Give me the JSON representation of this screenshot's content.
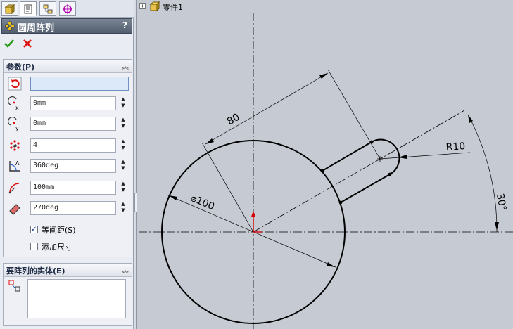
{
  "panel": {
    "tabs": [
      {
        "icon": "feature-manager-icon"
      },
      {
        "icon": "property-manager-icon"
      },
      {
        "icon": "configuration-manager-icon"
      },
      {
        "icon": "dimxpert-manager-icon"
      }
    ],
    "title": "圆周阵列",
    "help_label": "?",
    "ok_icon": "green-check-icon",
    "cancel_icon": "red-x-icon",
    "params_group": {
      "title": "参数(P)",
      "center_reference": "",
      "center_x": "0mm",
      "center_y": "0mm",
      "instance_count": "4",
      "total_angle": "360deg",
      "radius": "100mm",
      "start_angle": "270deg",
      "equal_spacing": {
        "label": "等间距(S)",
        "checked": true
      },
      "add_dimensions": {
        "label": "添加尺寸",
        "checked": false
      }
    },
    "entities_group": {
      "title": "要阵列的实体(E)"
    }
  },
  "tree": {
    "item_label": "零件1",
    "expander": "+"
  },
  "drawing": {
    "dim_length": "80",
    "dim_diameter": "⌀100",
    "dim_radius": "R10",
    "dim_angle": "30°",
    "colors": {
      "background": "#c6cad2",
      "sketch": "#000000",
      "origin": "#d40000"
    }
  }
}
